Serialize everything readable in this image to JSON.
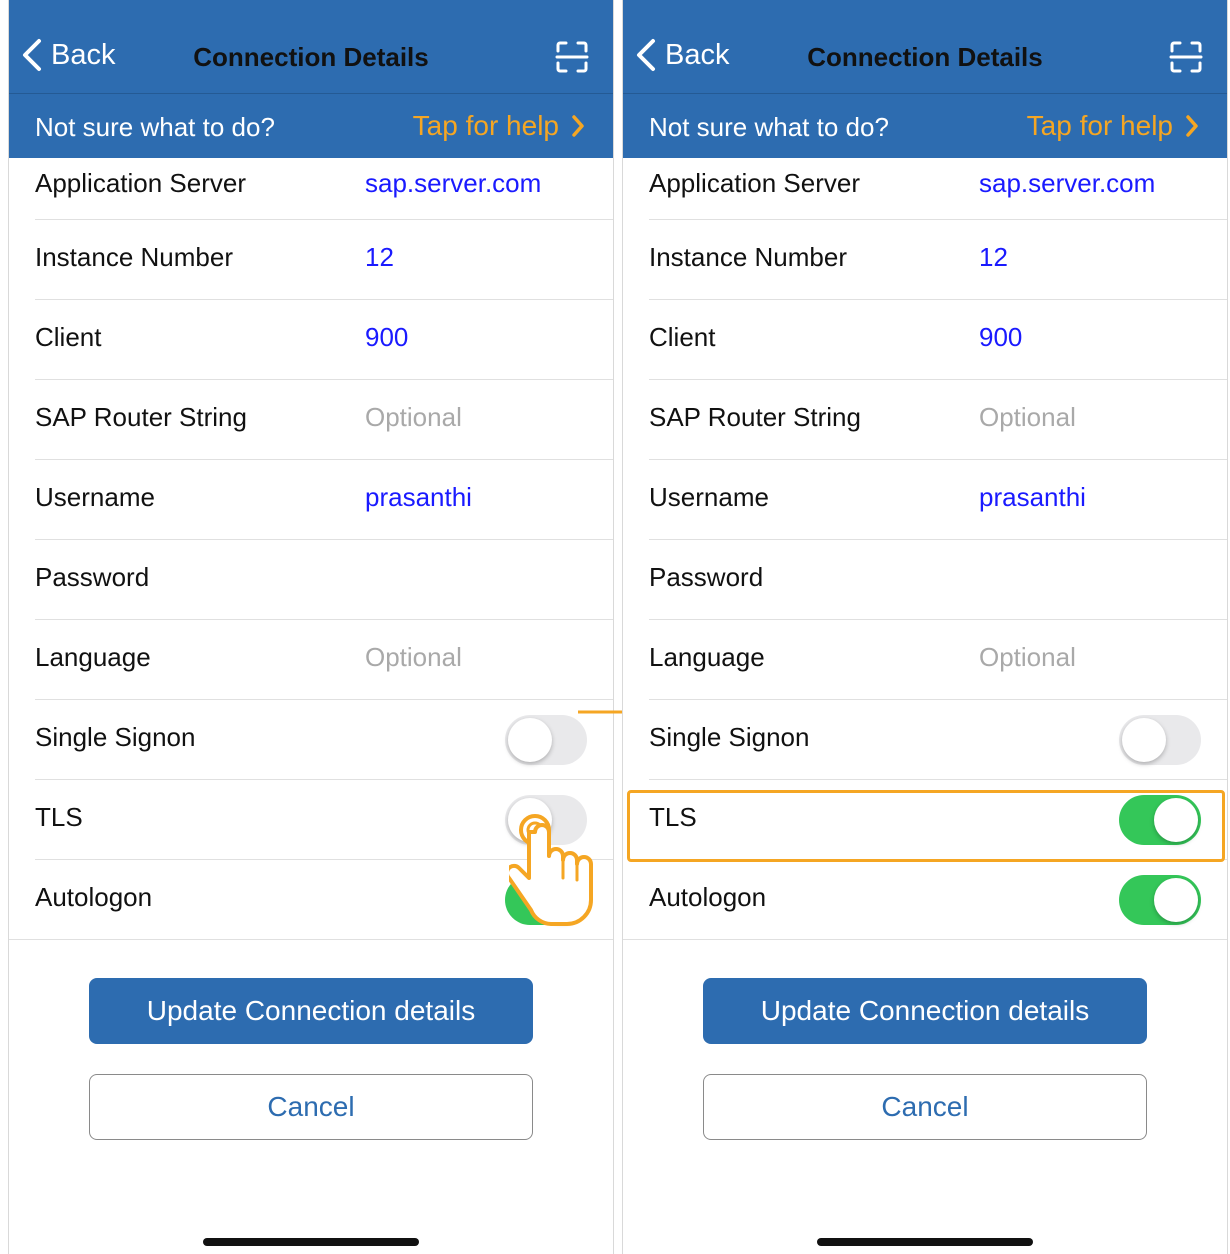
{
  "screens": [
    {
      "nav": {
        "back_label": "Back",
        "title": "Connection Details"
      },
      "help": {
        "prompt": "Not sure what to do?",
        "link": "Tap for help"
      },
      "fields": [
        {
          "label": "Application Server",
          "value": "sap.server.com"
        },
        {
          "label": "Instance Number",
          "value": "12"
        },
        {
          "label": "Client",
          "value": "900"
        },
        {
          "label": "SAP Router String",
          "placeholder": "Optional"
        },
        {
          "label": "Username",
          "value": "prasanthi"
        },
        {
          "label": "Password",
          "value": ""
        },
        {
          "label": "Language",
          "placeholder": "Optional"
        }
      ],
      "toggles": [
        {
          "label": "Single Signon",
          "on": false
        },
        {
          "label": "TLS",
          "on": false
        },
        {
          "label": "Autologon",
          "on": true
        }
      ],
      "buttons": {
        "update": "Update Connection details",
        "cancel": "Cancel"
      }
    },
    {
      "nav": {
        "back_label": "Back",
        "title": "Connection Details"
      },
      "help": {
        "prompt": "Not sure what to do?",
        "link": "Tap for help"
      },
      "fields": [
        {
          "label": "Application Server",
          "value": "sap.server.com"
        },
        {
          "label": "Instance Number",
          "value": "12"
        },
        {
          "label": "Client",
          "value": "900"
        },
        {
          "label": "SAP Router String",
          "placeholder": "Optional"
        },
        {
          "label": "Username",
          "value": "prasanthi"
        },
        {
          "label": "Password",
          "value": ""
        },
        {
          "label": "Language",
          "placeholder": "Optional"
        }
      ],
      "toggles": [
        {
          "label": "Single Signon",
          "on": false
        },
        {
          "label": "TLS",
          "on": true
        },
        {
          "label": "Autologon",
          "on": true
        }
      ],
      "buttons": {
        "update": "Update Connection details",
        "cancel": "Cancel"
      }
    }
  ],
  "colors": {
    "brand_blue": "#2d6cb0",
    "help_link": "#f5a623",
    "value_text": "#1a1aff",
    "placeholder": "#a9a9a9",
    "toggle_on": "#34c759",
    "highlight": "#f5a623"
  },
  "icons": {
    "back": "chevron-left-icon",
    "scan": "scan-frame-icon",
    "help": "chevron-right-icon",
    "gesture": "tap-hand-icon",
    "transition": "arrow-right-icon"
  }
}
